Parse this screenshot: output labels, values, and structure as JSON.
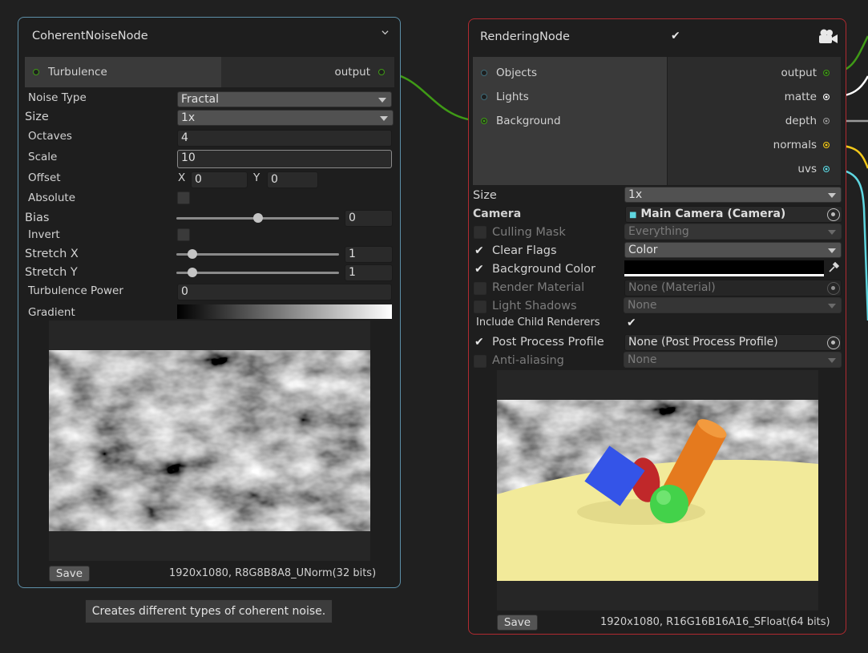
{
  "noise_node": {
    "title": "CoherentNoiseNode",
    "input_port": "Turbulence",
    "output_port": "output",
    "fields": {
      "noise_type_label": "Noise Type",
      "noise_type_value": "Fractal",
      "size_label": "Size",
      "size_value": "1x",
      "octaves_label": "Octaves",
      "octaves_value": "4",
      "scale_label": "Scale",
      "scale_value": "10",
      "offset_label": "Offset",
      "offset_x_label": "X",
      "offset_x_value": "0",
      "offset_y_label": "Y",
      "offset_y_value": "0",
      "absolute_label": "Absolute",
      "bias_label": "Bias",
      "bias_value": "0",
      "bias_level": 0.5,
      "invert_label": "Invert",
      "stretch_x_label": "Stretch X",
      "stretch_x_value": "1",
      "stretch_x_level": 0.1,
      "stretch_y_label": "Stretch Y",
      "stretch_y_value": "1",
      "stretch_y_level": 0.1,
      "turbulence_power_label": "Turbulence Power",
      "turbulence_power_value": "0",
      "gradient_label": "Gradient"
    },
    "save_label": "Save",
    "texture_info": "1920x1080, R8G8B8A8_UNorm(32 bits)",
    "tooltip": "Creates different types of coherent noise."
  },
  "render_node": {
    "title": "RenderingNode",
    "inputs": [
      "Objects",
      "Lights",
      "Background"
    ],
    "outputs": [
      "output",
      "matte",
      "depth",
      "normals",
      "uvs"
    ],
    "fields": {
      "size_label": "Size",
      "size_value": "1x",
      "camera_label": "Camera",
      "camera_value": "Main Camera (Camera)",
      "culling_mask_label": "Culling Mask",
      "culling_mask_value": "Everything",
      "clear_flags_label": "Clear Flags",
      "clear_flags_value": "Color",
      "background_color_label": "Background Color",
      "render_material_label": "Render Material",
      "render_material_value": "None (Material)",
      "light_shadows_label": "Light Shadows",
      "light_shadows_value": "None",
      "include_child_label": "Include Child Renderers",
      "post_process_label": "Post Process Profile",
      "post_process_value": "None (Post Process Profile)",
      "anti_aliasing_label": "Anti-aliasing",
      "anti_aliasing_value": "None"
    },
    "save_label": "Save",
    "texture_info": "1920x1080, R16G16B16A16_SFloat(64 bits)"
  },
  "colors": {
    "noise_border": "#5d8fa8",
    "render_border": "#b02a30",
    "edge_green": "#3f9a16",
    "edge_white": "#ffffff",
    "edge_gray": "#9a9a9a",
    "edge_yellow": "#f2c81a",
    "edge_cyan": "#5fd6e0"
  }
}
